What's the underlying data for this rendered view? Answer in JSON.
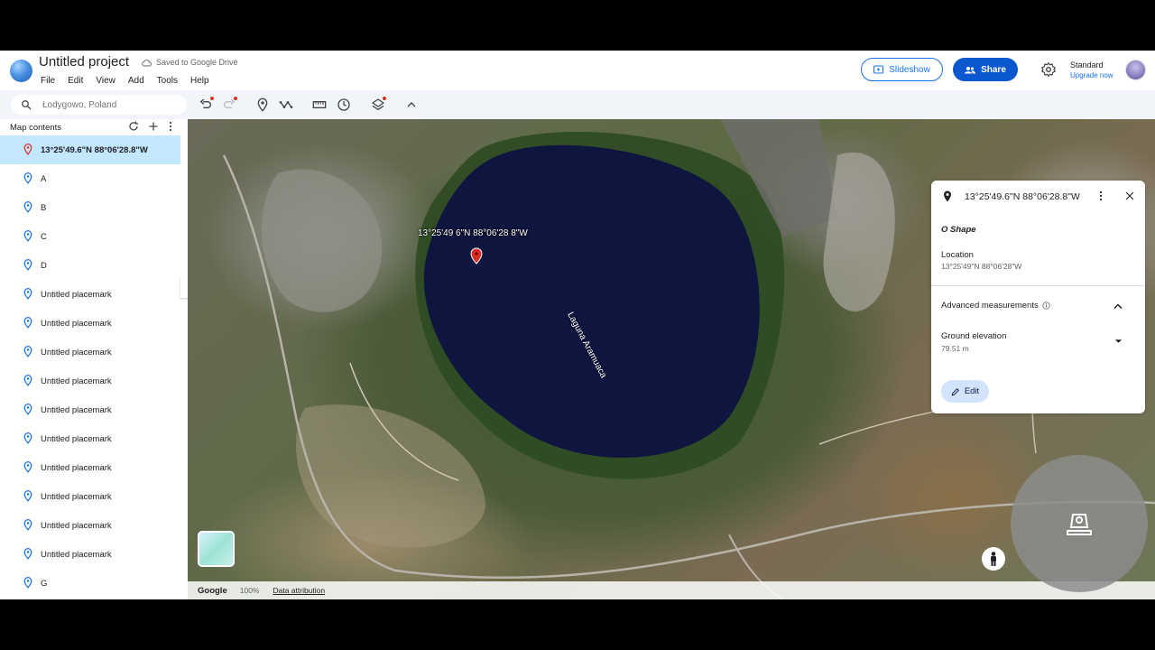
{
  "header": {
    "title": "Untitled project",
    "saved_status": "Saved to Google Drive",
    "menu": [
      "File",
      "Edit",
      "View",
      "Add",
      "Tools",
      "Help"
    ],
    "slideshow_label": "Slideshow",
    "share_label": "Share",
    "plan": "Standard",
    "upgrade": "Upgrade now"
  },
  "toolbar": {
    "search_placeholder": "Łodygowo, Poland"
  },
  "sidebar": {
    "title": "Map contents",
    "items": [
      {
        "label": "13°25'49.6\"N 88°06'28.8\"W",
        "selected": true
      },
      {
        "label": "A"
      },
      {
        "label": "B"
      },
      {
        "label": "C"
      },
      {
        "label": "D"
      },
      {
        "label": "Untitled placemark"
      },
      {
        "label": "Untitled placemark"
      },
      {
        "label": "Untitled placemark"
      },
      {
        "label": "Untitled placemark"
      },
      {
        "label": "Untitled placemark"
      },
      {
        "label": "Untitled placemark"
      },
      {
        "label": "Untitled placemark"
      },
      {
        "label": "Untitled placemark"
      },
      {
        "label": "Untitled placemark"
      },
      {
        "label": "Untitled placemark"
      },
      {
        "label": "G"
      }
    ]
  },
  "map": {
    "placemark_label": "13°25'49 6\"N 88°06'28 8\"W",
    "lake_name": "Laguna Aramuaca",
    "attribution_brand": "Google",
    "zoom": "100%",
    "data_attribution": "Data attribution"
  },
  "panel": {
    "title": "13°25'49.6\"N 88°06'28.8\"W",
    "shape_name": "O Shape",
    "location_label": "Location",
    "location_value": "13°25'49\"N 88°06'28\"W",
    "advanced_label": "Advanced measurements",
    "elevation_label": "Ground elevation",
    "elevation_value": "79.51 m",
    "edit_label": "Edit"
  },
  "colors": {
    "accent": "#1a73e8",
    "share_bg": "#0b57d0",
    "selected_row": "#c2e7ff",
    "placemark_red": "#d93025",
    "lake": "#0e1640"
  }
}
